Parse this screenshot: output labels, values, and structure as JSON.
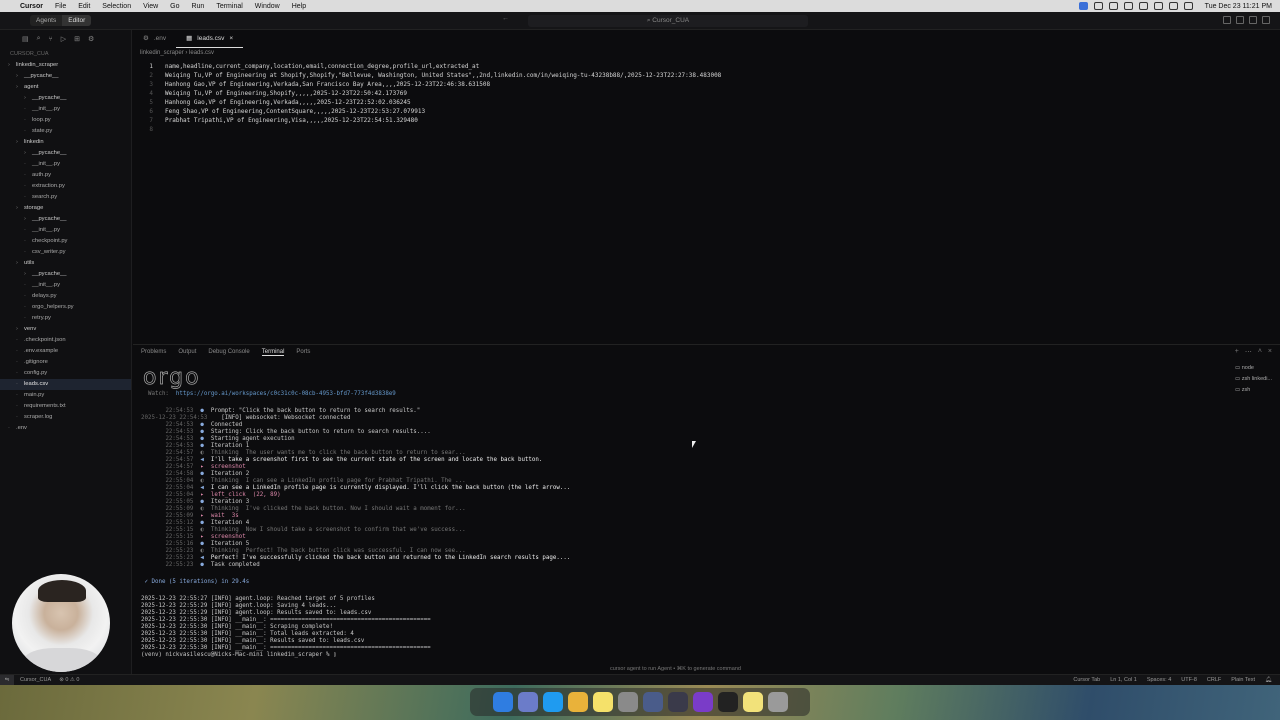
{
  "menubar": {
    "app": "Cursor",
    "items": [
      "File",
      "Edit",
      "Selection",
      "View",
      "Go",
      "Run",
      "Terminal",
      "Window",
      "Help"
    ],
    "clock": "Tue Dec 23  11:21 PM"
  },
  "titlebar": {
    "mode_agents": "Agents",
    "mode_editor": "Editor",
    "command_center": "Cursor_CUA"
  },
  "sidebar": {
    "section": "CURSOR_CUA",
    "items": [
      {
        "label": "linkedin_scraper",
        "depth": 0,
        "kind": "dir"
      },
      {
        "label": "__pycache__",
        "depth": 1,
        "kind": "dir"
      },
      {
        "label": "agent",
        "depth": 1,
        "kind": "dir"
      },
      {
        "label": "__pycache__",
        "depth": 2,
        "kind": "dir"
      },
      {
        "label": "__init__.py",
        "depth": 2,
        "kind": "file"
      },
      {
        "label": "loop.py",
        "depth": 2,
        "kind": "file"
      },
      {
        "label": "state.py",
        "depth": 2,
        "kind": "file"
      },
      {
        "label": "linkedin",
        "depth": 1,
        "kind": "dir"
      },
      {
        "label": "__pycache__",
        "depth": 2,
        "kind": "dir"
      },
      {
        "label": "__init__.py",
        "depth": 2,
        "kind": "file"
      },
      {
        "label": "auth.py",
        "depth": 2,
        "kind": "file"
      },
      {
        "label": "extraction.py",
        "depth": 2,
        "kind": "file"
      },
      {
        "label": "search.py",
        "depth": 2,
        "kind": "file"
      },
      {
        "label": "storage",
        "depth": 1,
        "kind": "dir"
      },
      {
        "label": "__pycache__",
        "depth": 2,
        "kind": "dir"
      },
      {
        "label": "__init__.py",
        "depth": 2,
        "kind": "file"
      },
      {
        "label": "checkpoint.py",
        "depth": 2,
        "kind": "file"
      },
      {
        "label": "csv_writer.py",
        "depth": 2,
        "kind": "file"
      },
      {
        "label": "utils",
        "depth": 1,
        "kind": "dir"
      },
      {
        "label": "__pycache__",
        "depth": 2,
        "kind": "dir"
      },
      {
        "label": "__init__.py",
        "depth": 2,
        "kind": "file"
      },
      {
        "label": "delays.py",
        "depth": 2,
        "kind": "file"
      },
      {
        "label": "orgo_helpers.py",
        "depth": 2,
        "kind": "file"
      },
      {
        "label": "retry.py",
        "depth": 2,
        "kind": "file"
      },
      {
        "label": "venv",
        "depth": 1,
        "kind": "dir"
      },
      {
        "label": ".checkpoint.json",
        "depth": 1,
        "kind": "file"
      },
      {
        "label": ".env.example",
        "depth": 1,
        "kind": "file"
      },
      {
        "label": ".gitignore",
        "depth": 1,
        "kind": "file"
      },
      {
        "label": "config.py",
        "depth": 1,
        "kind": "file"
      },
      {
        "label": "leads.csv",
        "depth": 1,
        "kind": "file",
        "selected": true
      },
      {
        "label": "main.py",
        "depth": 1,
        "kind": "file"
      },
      {
        "label": "requirements.txt",
        "depth": 1,
        "kind": "file"
      },
      {
        "label": "scraper.log",
        "depth": 1,
        "kind": "file"
      },
      {
        "label": ".env",
        "depth": 0,
        "kind": "file"
      }
    ]
  },
  "tabs": [
    {
      "label": ".env",
      "active": false
    },
    {
      "label": "leads.csv",
      "active": true
    }
  ],
  "breadcrumb": {
    "folder": "linkedin_scraper",
    "file": "leads.csv"
  },
  "editor_lines": [
    "name,headline,current_company,location,email,connection_degree,profile_url,extracted_at",
    "Weiqing Tu,VP of Engineering at Shopify,Shopify,\"Bellevue, Washington, United States\",,2nd,linkedin.com/in/weiqing-tu-43238b88/,2025-12-23T22:27:38.483008",
    "Hanhong Gao,VP of Engineering,Verkada,San Francisco Bay Area,,,,2025-12-23T22:46:38.631508",
    "Weiqing Tu,VP of Engineering,Shopify,,,,,2025-12-23T22:50:42.173769",
    "Hanhong Gao,VP of Engineering,Verkada,,,,,2025-12-23T22:52:02.036245",
    "Feng Shao,VP of Engineering,ContentSquare,,,,,2025-12-23T22:53:27.079913",
    "Prabhat Tripathi,VP of Engineering,Visa,,,,,2025-12-23T22:54:51.329480",
    ""
  ],
  "panel": {
    "tabs": [
      "Problems",
      "Output",
      "Debug Console",
      "Terminal",
      "Ports"
    ],
    "active": "Terminal",
    "sessions": [
      "node",
      "zsh linkedi...",
      "zsh"
    ]
  },
  "terminal": {
    "ascii_logo": "orgo",
    "watch_label": "Watch:",
    "watch_url": "https://orgo.ai/workspaces/c0c31c0c-08cb-4953-bfd7-773f4d3838e9",
    "log": [
      {
        "ts": "22:54:53",
        "mark": "●",
        "text": "Prompt: \"Click the back button to return to search results.\"",
        "cls": ""
      },
      {
        "ts": "2025-12-23 22:54:53",
        "mark": "",
        "text": "[INFO] websocket: Websocket connected",
        "cls": ""
      },
      {
        "ts": "22:54:53",
        "mark": "●",
        "text": "Connected",
        "cls": ""
      },
      {
        "ts": "22:54:53",
        "mark": "●",
        "text": "Starting: Click the back button to return to search results....",
        "cls": ""
      },
      {
        "ts": "22:54:53",
        "mark": "●",
        "text": "Starting agent execution",
        "cls": ""
      },
      {
        "ts": "22:54:53",
        "mark": "●",
        "text": "Iteration 1",
        "cls": ""
      },
      {
        "ts": "22:54:57",
        "mark": "◐",
        "text": "Thinking  The user wants me to click the back button to return to sear...",
        "cls": "dim"
      },
      {
        "ts": "22:54:57",
        "mark": "◀",
        "text": "I'll take a screenshot first to see the current state of the screen and locate the back button.",
        "cls": "bold"
      },
      {
        "ts": "22:54:57",
        "mark": "▸",
        "text": "screenshot",
        "cls": "tool"
      },
      {
        "ts": "22:54:58",
        "mark": "●",
        "text": "Iteration 2",
        "cls": ""
      },
      {
        "ts": "22:55:04",
        "mark": "◐",
        "text": "Thinking  I can see a LinkedIn profile page for Prabhat Tripathi. The ...",
        "cls": "dim"
      },
      {
        "ts": "22:55:04",
        "mark": "◀",
        "text": "I can see a LinkedIn profile page is currently displayed. I'll click the back button (the left arrow...",
        "cls": "bold"
      },
      {
        "ts": "22:55:04",
        "mark": "▸",
        "text": "left_click  (22, 89)",
        "cls": "tool"
      },
      {
        "ts": "22:55:05",
        "mark": "●",
        "text": "Iteration 3",
        "cls": ""
      },
      {
        "ts": "22:55:09",
        "mark": "◐",
        "text": "Thinking  I've clicked the back button. Now I should wait a moment for...",
        "cls": "dim"
      },
      {
        "ts": "22:55:09",
        "mark": "▸",
        "text": "wait  3s",
        "cls": "tool"
      },
      {
        "ts": "22:55:12",
        "mark": "●",
        "text": "Iteration 4",
        "cls": ""
      },
      {
        "ts": "22:55:15",
        "mark": "◐",
        "text": "Thinking  Now I should take a screenshot to confirm that we've success...",
        "cls": "dim"
      },
      {
        "ts": "22:55:15",
        "mark": "▸",
        "text": "screenshot",
        "cls": "tool"
      },
      {
        "ts": "22:55:16",
        "mark": "●",
        "text": "Iteration 5",
        "cls": ""
      },
      {
        "ts": "22:55:23",
        "mark": "◐",
        "text": "Thinking  Perfect! The back button click was successful. I can now see...",
        "cls": "dim"
      },
      {
        "ts": "22:55:23",
        "mark": "◀",
        "text": "Perfect! I've successfully clicked the back button and returned to the LinkedIn search results page....",
        "cls": "bold"
      },
      {
        "ts": "22:55:23",
        "mark": "●",
        "text": "Task completed",
        "cls": ""
      }
    ],
    "done": "✓ Done (5 iterations) in 29.4s",
    "tail": [
      "2025-12-23 22:55:27 [INFO] agent.loop: Reached target of 5 profiles",
      "2025-12-23 22:55:29 [INFO] agent.loop: Saving 4 leads...",
      "2025-12-23 22:55:29 [INFO] agent.loop: Results saved to: leads.csv",
      "2025-12-23 22:55:30 [INFO] __main__: ==============================================",
      "2025-12-23 22:55:30 [INFO] __main__: Scraping complete!",
      "2025-12-23 22:55:30 [INFO] __main__: Total leads extracted: 4",
      "2025-12-23 22:55:30 [INFO] __main__: Results saved to: leads.csv",
      "2025-12-23 22:55:30 [INFO] __main__: =============================================="
    ],
    "prompt": "(venv) nickvasilescu@Nicks-Mac-mini linkedin_scraper % ",
    "hint": "cursor agent to run Agent • ⌘K to generate command"
  },
  "statusbar": {
    "workspace": "Cursor_CUA",
    "problems": "⊗ 0 ⚠ 0",
    "tab": "Cursor Tab",
    "position": "Ln 1, Col 1",
    "spaces": "Spaces: 4",
    "encoding": "UTF-8",
    "eol": "CRLF",
    "language": "Plain Text"
  },
  "dock_colors": [
    "#2f7de1",
    "#6b7cc9",
    "#1f9bf0",
    "#e9b23a",
    "#f5e16a",
    "#8a8a8a",
    "#4a5c8a",
    "#3a3a4a",
    "#7a3cc8",
    "#222222",
    "#f2e27a",
    "#9a9a9a"
  ]
}
